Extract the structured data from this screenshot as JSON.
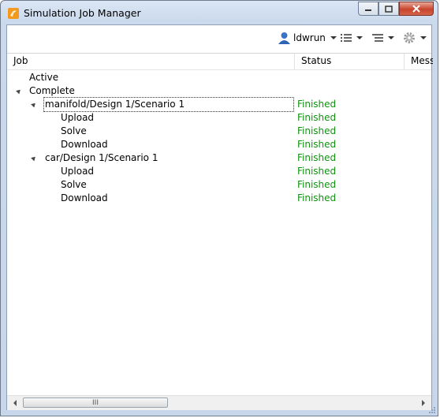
{
  "window": {
    "title": "Simulation Job Manager"
  },
  "toolbar": {
    "user": "ldwrun",
    "icons": [
      "user-icon",
      "list-view-icon",
      "tree-view-icon",
      "settings-gear-icon"
    ]
  },
  "columns": [
    "Job",
    "Status",
    "Mess"
  ],
  "jobs": {
    "active": "Active",
    "complete": "Complete",
    "items": [
      {
        "name": "manifold/Design 1/Scenario 1",
        "status": "Finished",
        "children": [
          {
            "name": "Upload",
            "status": "Finished"
          },
          {
            "name": "Solve",
            "status": "Finished"
          },
          {
            "name": "Download",
            "status": "Finished"
          }
        ]
      },
      {
        "name": "car/Design 1/Scenario 1",
        "status": "Finished",
        "children": [
          {
            "name": "Upload",
            "status": "Finished"
          },
          {
            "name": "Solve",
            "status": "Finished"
          },
          {
            "name": "Download",
            "status": "Finished"
          }
        ]
      }
    ]
  },
  "colors": {
    "status_finished": "#119211",
    "window_frame": "#c7d6ea",
    "close_button": "#c7442c"
  },
  "scrollbar": {
    "grip": "III"
  }
}
